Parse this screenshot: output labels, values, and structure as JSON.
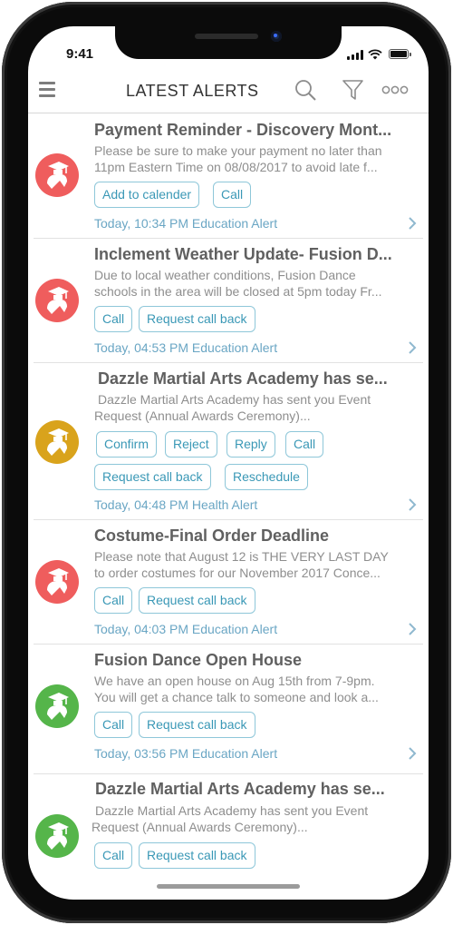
{
  "status": {
    "time": "9:41"
  },
  "header": {
    "title": "LATEST ALERTS",
    "icons": [
      "hamburger-menu-icon",
      "search-icon",
      "filter-icon",
      "more-icon"
    ]
  },
  "colors": {
    "red": "#ef5d5d",
    "gold": "#d9a31c",
    "green": "#55b54a",
    "accent": "#3a98b6",
    "meta": "#6aa6c4"
  },
  "alerts": [
    {
      "avatar_color": "#ef5d5d",
      "title": "Payment Reminder - Discovery Mont...",
      "body": [
        "Please be sure to make your payment no later than",
        "11pm Eastern Time on 08/08/2017  to avoid late f..."
      ],
      "buttons": [
        "Add to calender",
        "Call"
      ],
      "meta": "Today, 10:34 PM Education Alert"
    },
    {
      "avatar_color": "#ef5d5d",
      "title": "Inclement Weather Update- Fusion D...",
      "body": [
        "Due to local weather conditions, Fusion Dance",
        "schools in the area will be closed at 5pm today Fr..."
      ],
      "buttons": [
        "Call",
        "Request call back"
      ],
      "meta": "Today, 04:53 PM Education Alert"
    },
    {
      "avatar_color": "#d9a31c",
      "title": "Dazzle Martial Arts Academy  has se...",
      "body": [
        "Dazzle Martial Arts Academy  has sent you Event",
        "Request (Annual Awards Ceremony)..."
      ],
      "buttons": [
        "Confirm",
        "Reject",
        "Reply",
        "Call"
      ],
      "buttons2": [
        "Request call back",
        "Reschedule"
      ],
      "meta": "Today, 04:48 PM Health Alert"
    },
    {
      "avatar_color": "#ef5d5d",
      "title": "Costume-Final Order Deadline",
      "body": [
        "Please note that August 12 is THE VERY LAST DAY",
        "to order costumes for our November 2017 Conce..."
      ],
      "buttons": [
        "Call",
        "Request call back"
      ],
      "meta": "Today, 04:03 PM Education Alert"
    },
    {
      "avatar_color": "#55b54a",
      "title": "Fusion Dance Open House",
      "body": [
        "We have an open house on Aug 15th from 7-9pm.",
        "You will get a chance  talk to someone and look a..."
      ],
      "buttons": [
        "Call",
        "Request call back"
      ],
      "meta": "Today, 03:56 PM Education Alert"
    },
    {
      "avatar_color": "#55b54a",
      "title": "Dazzle Martial Arts Academy  has se...",
      "body": [
        "Dazzle Martial Arts Academy  has sent you Event",
        "Request (Annual Awards Ceremony)..."
      ],
      "buttons": [
        "Call",
        "Request call back"
      ],
      "meta": ""
    }
  ]
}
